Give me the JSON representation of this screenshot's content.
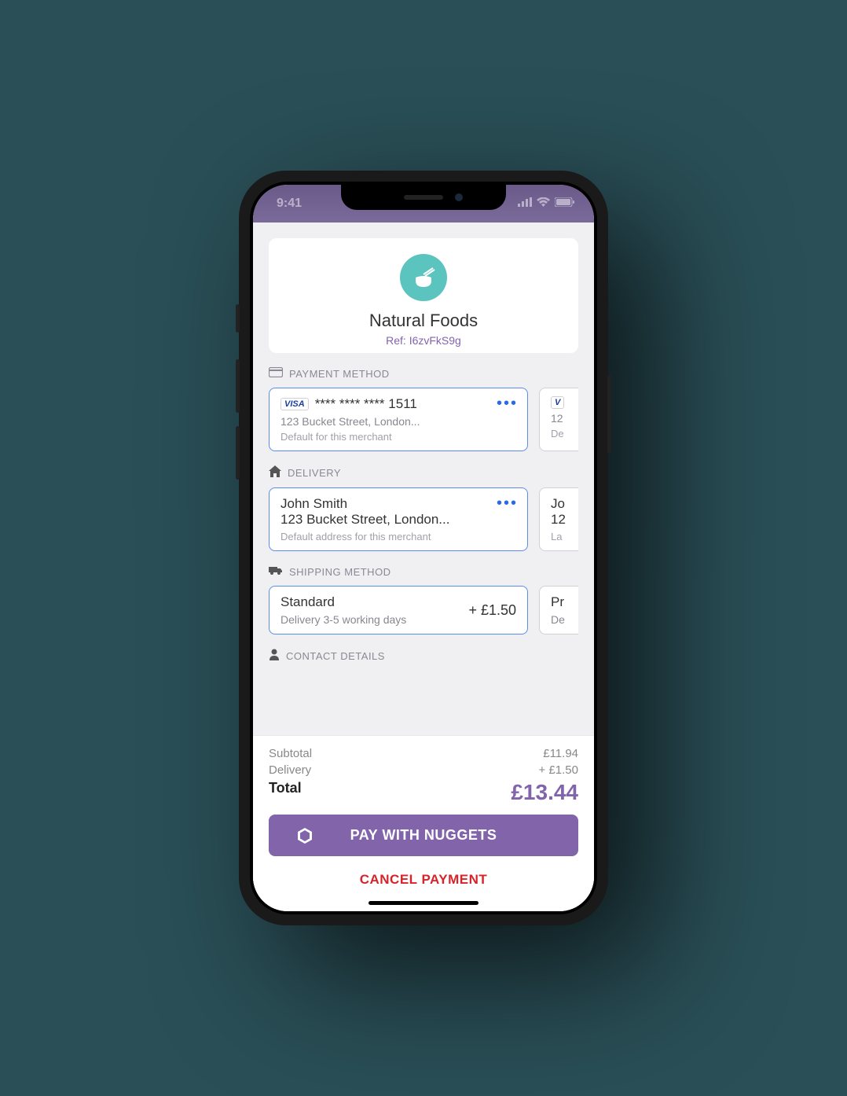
{
  "status": {
    "time": "9:41"
  },
  "merchant": {
    "name": "Natural Foods",
    "ref": "Ref: I6zvFkS9g"
  },
  "sections": {
    "payment": {
      "label": "PAYMENT METHOD",
      "card_brand": "VISA",
      "card_number": "**** **** **** 1511",
      "address": "123 Bucket Street, London...",
      "note": "Default for this merchant",
      "peek_address": "12",
      "peek_note": "De"
    },
    "delivery": {
      "label": "DELIVERY",
      "name": "John Smith",
      "address": "123 Bucket Street, London...",
      "note": "Default address for this merchant",
      "peek_name": "Jo",
      "peek_address": "12",
      "peek_note": "La"
    },
    "shipping": {
      "label": "SHIPPING METHOD",
      "name": "Standard",
      "desc": "Delivery 3-5 working days",
      "price": "+ £1.50",
      "peek_name": "Pr",
      "peek_desc": "De"
    },
    "contact": {
      "label": "CONTACT DETAILS"
    }
  },
  "totals": {
    "subtotal_label": "Subtotal",
    "subtotal": "£11.94",
    "delivery_label": "Delivery",
    "delivery": "+ £1.50",
    "total_label": "Total",
    "total": "£13.44"
  },
  "actions": {
    "pay": "PAY WITH NUGGETS",
    "cancel": "CANCEL PAYMENT"
  }
}
